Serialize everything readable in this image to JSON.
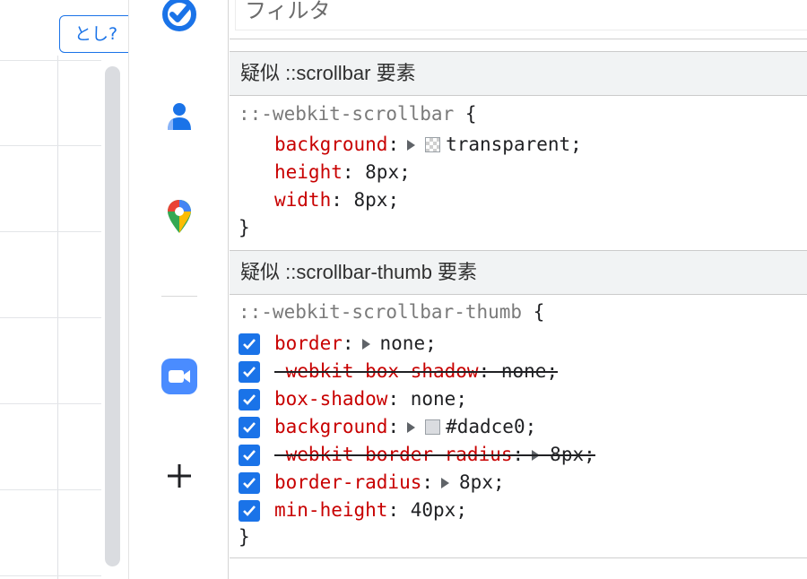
{
  "page": {
    "partial_button_label": "とし?"
  },
  "dock": {
    "icons": [
      "tasks-check-icon",
      "contacts-person-icon",
      "maps-pin-icon",
      "video-meeting-icon",
      "add-icon"
    ]
  },
  "devtools": {
    "filter_placeholder": "フィルタ",
    "sections": [
      {
        "header": "疑似 ::scrollbar 要素",
        "selector": "::-webkit-scrollbar",
        "declarations": [
          {
            "prop": "background",
            "value": "transparent",
            "expandable": true,
            "swatch": "transparent",
            "checked": false,
            "struck": false
          },
          {
            "prop": "height",
            "value": "8px",
            "expandable": false,
            "checked": false,
            "struck": false
          },
          {
            "prop": "width",
            "value": "8px",
            "expandable": false,
            "checked": false,
            "struck": false
          }
        ]
      },
      {
        "header": "疑似 ::scrollbar-thumb 要素",
        "selector": "::-webkit-scrollbar-thumb",
        "declarations": [
          {
            "prop": "border",
            "value": "none",
            "expandable": true,
            "checked": true,
            "struck": false
          },
          {
            "prop": "-webkit-box-shadow",
            "value": "none",
            "expandable": false,
            "checked": true,
            "struck": true
          },
          {
            "prop": "box-shadow",
            "value": "none",
            "expandable": false,
            "checked": true,
            "struck": false
          },
          {
            "prop": "background",
            "value": "#dadce0",
            "expandable": true,
            "swatch": "#dadce0",
            "checked": true,
            "struck": false
          },
          {
            "prop": "-webkit-border-radius",
            "value": "8px",
            "expandable": true,
            "checked": true,
            "struck": true
          },
          {
            "prop": "border-radius",
            "value": "8px",
            "expandable": true,
            "checked": true,
            "struck": false
          },
          {
            "prop": "min-height",
            "value": "40px",
            "expandable": false,
            "checked": true,
            "struck": false
          }
        ]
      }
    ]
  },
  "colors": {
    "accent": "#1a73e8",
    "property": "#c80000",
    "scroll_thumb": "#dadce0"
  }
}
